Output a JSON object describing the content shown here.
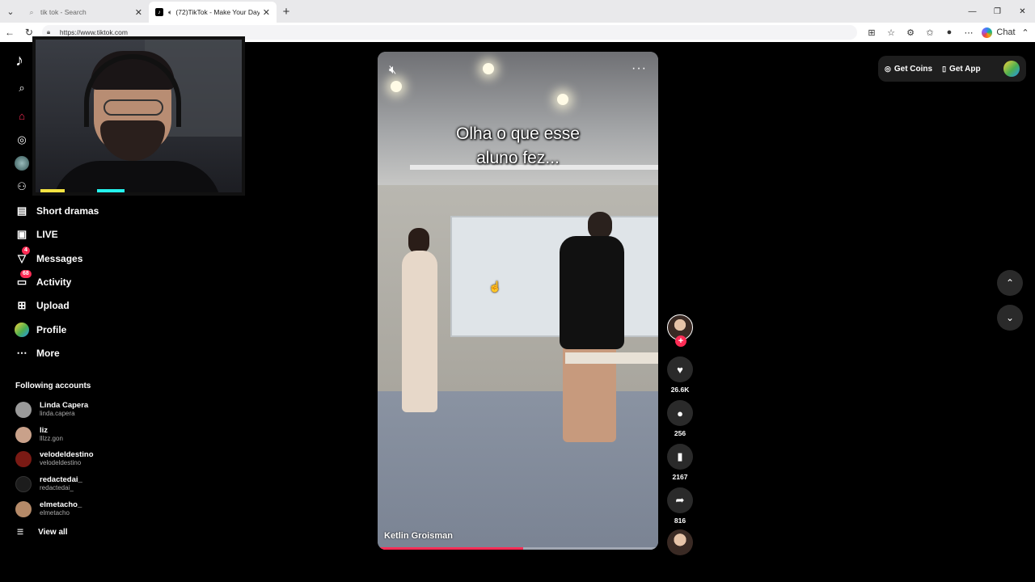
{
  "browser": {
    "tabs": [
      {
        "title": "tik tok - Search",
        "active": false
      },
      {
        "title": "(72)TikTok - Make Your Day",
        "active": true
      }
    ],
    "url": "https://www.tiktok.com",
    "chat_label": "Chat"
  },
  "sidebar": {
    "items": [
      {
        "label": "Short dramas",
        "icon": "film-icon"
      },
      {
        "label": "LIVE",
        "icon": "live-icon"
      },
      {
        "label": "Messages",
        "icon": "send-icon",
        "badge": "4"
      },
      {
        "label": "Activity",
        "icon": "inbox-icon",
        "badge": "68"
      },
      {
        "label": "Upload",
        "icon": "plus-square-icon"
      },
      {
        "label": "Profile",
        "icon": "avatar"
      },
      {
        "label": "More",
        "icon": "more-icon"
      }
    ],
    "following_title": "Following accounts",
    "accounts": [
      {
        "name": "Linda Capera",
        "handle": "linda.capera",
        "color": "#9a9a9a"
      },
      {
        "name": "liz",
        "handle": "lllzz.gon",
        "color": "#c9a18a"
      },
      {
        "name": "velodeldestino",
        "handle": "velodeldestino",
        "color": "#7a1a14"
      },
      {
        "name": "redactedai_",
        "handle": "redactedai_",
        "color": "#1c1c1c"
      },
      {
        "name": "elmetacho_",
        "handle": "elmetacho",
        "color": "#b58a68"
      }
    ],
    "view_all": "View all"
  },
  "video": {
    "caption_line1": "Olha o que esse",
    "caption_line2": "aluno fez...",
    "author": "Ketlin Groisman",
    "progress": 0.52
  },
  "actions": {
    "likes": "26.6K",
    "comments": "256",
    "saves": "2167",
    "shares": "816"
  },
  "topbar": {
    "get_coins": "Get Coins",
    "get_app": "Get App"
  },
  "colors": {
    "accent": "#fe2c55"
  }
}
